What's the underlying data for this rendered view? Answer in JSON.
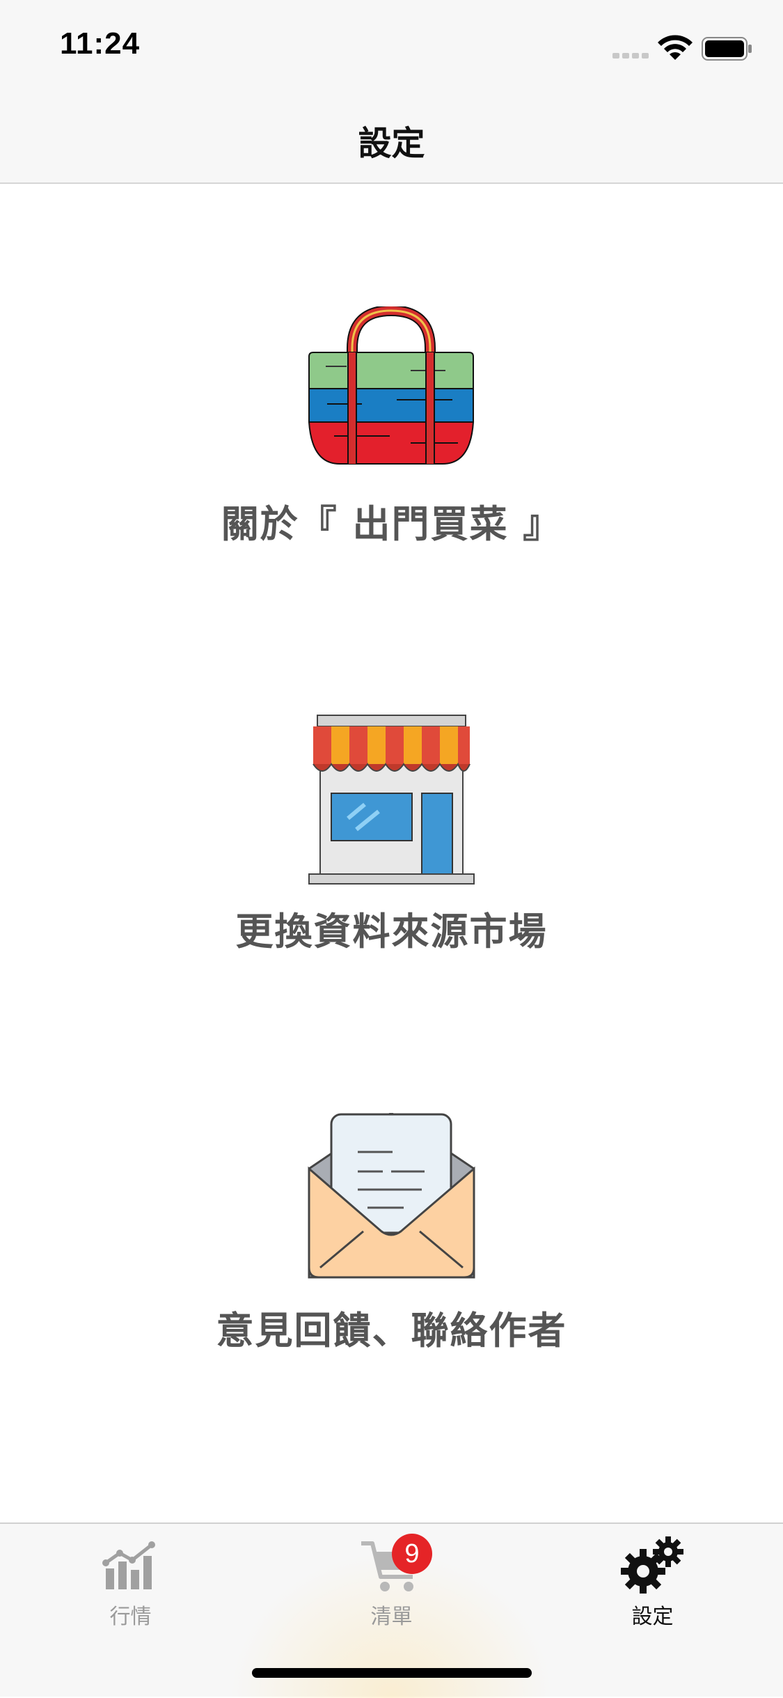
{
  "status_bar": {
    "time": "11:24"
  },
  "nav": {
    "title": "設定"
  },
  "menu": {
    "items": [
      {
        "label": "關於『 出門買菜 』",
        "icon": "shopping-bag-icon"
      },
      {
        "label": "更換資料來源市場",
        "icon": "market-store-icon"
      },
      {
        "label": "意見回饋、聯絡作者",
        "icon": "mail-envelope-icon"
      }
    ]
  },
  "tabbar": {
    "tabs": [
      {
        "label": "行情",
        "icon": "chart-icon",
        "active": false
      },
      {
        "label": "清單",
        "icon": "cart-icon",
        "active": false,
        "badge": "9"
      },
      {
        "label": "設定",
        "icon": "gears-icon",
        "active": true
      }
    ]
  },
  "colors": {
    "badge": "#e52427",
    "inactive": "#9a9a9a",
    "active": "#111111"
  }
}
